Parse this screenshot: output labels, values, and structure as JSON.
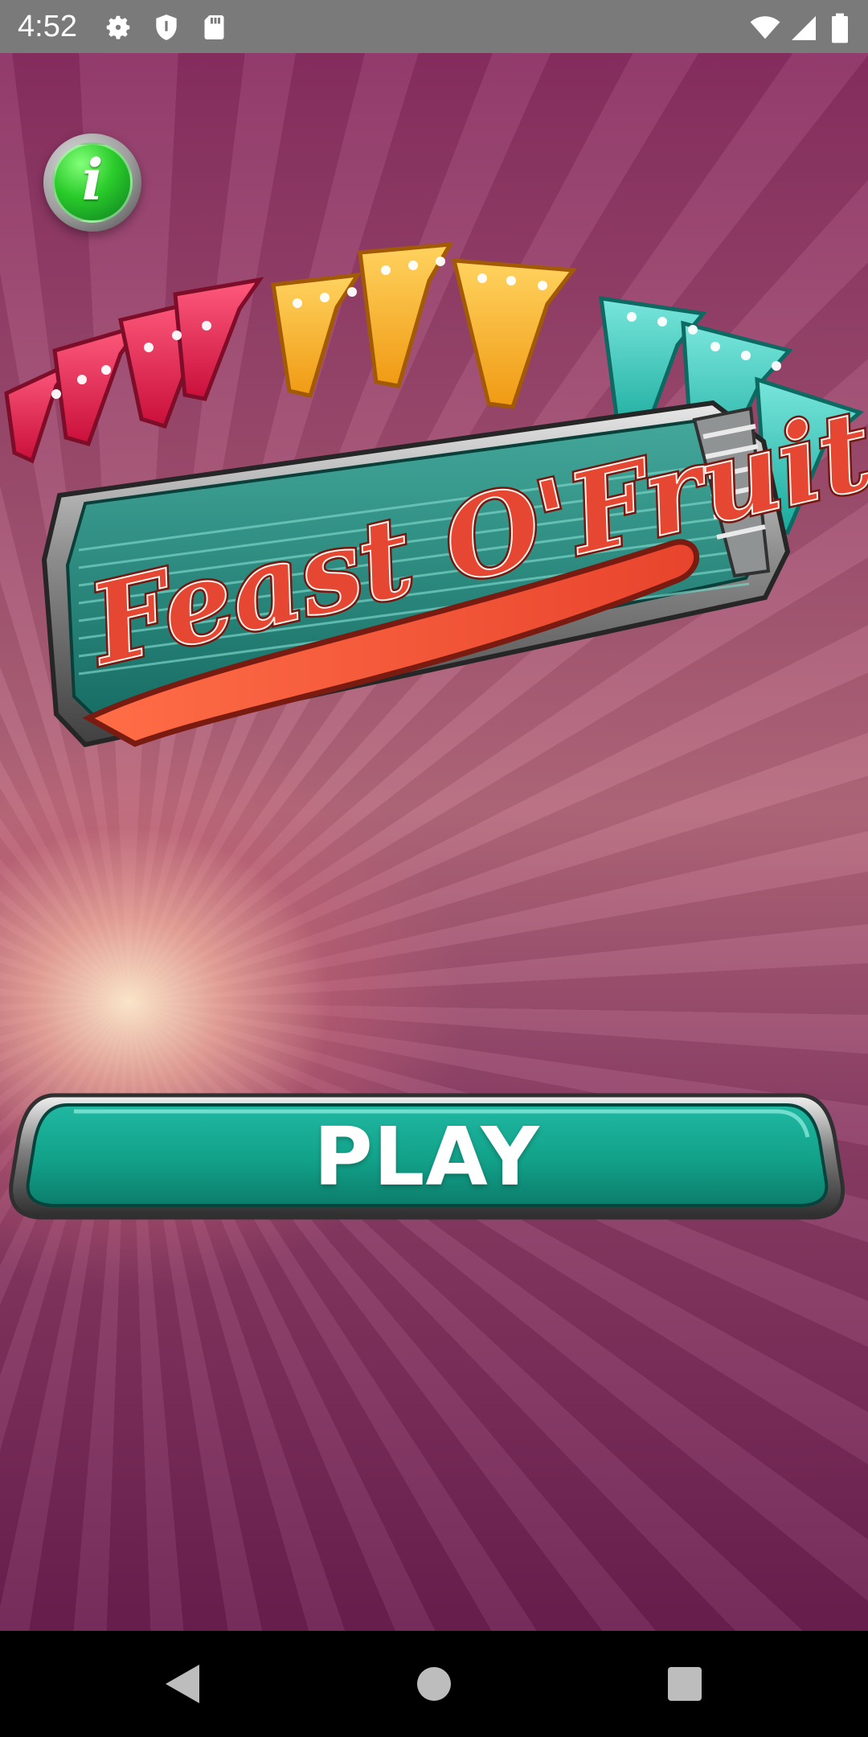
{
  "status_bar": {
    "time": "4:52",
    "icons": [
      "settings-gear-icon",
      "shield-icon",
      "sd-card-icon",
      "wifi-icon",
      "signal-icon",
      "battery-icon"
    ]
  },
  "game": {
    "title_logo_text": "Feast O'Fruit",
    "play_button_label": "PLAY",
    "info_button_glyph": "i"
  },
  "navigation": {
    "buttons": [
      "back-button",
      "home-button",
      "recents-button"
    ]
  },
  "colors": {
    "status_bar_bg": "#7a7a7a",
    "play_button": "#16b59b",
    "info_button": "#20b52f",
    "sevens_red": "#e51e4f",
    "sevens_yellow": "#f5b433",
    "sevens_teal": "#35c8b8",
    "logo_text_orange": "#e64732"
  }
}
